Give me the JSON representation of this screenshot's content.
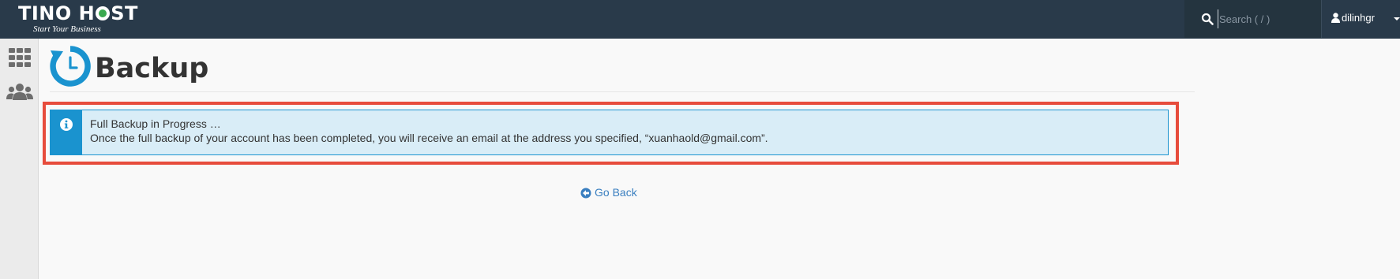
{
  "brand": {
    "name_before": "TINO H",
    "name_after": "ST",
    "tagline": "Start Your Business",
    "accent_color": "#3aa94f"
  },
  "topbar": {
    "background_color": "#293a4a",
    "search": {
      "placeholder": "Search ( / )",
      "icon": "search-icon"
    },
    "user": {
      "username": "dilinhgr",
      "icon": "user-icon"
    }
  },
  "sidebar": {
    "items": [
      {
        "icon": "apps-grid-icon"
      },
      {
        "icon": "users-icon"
      }
    ]
  },
  "page": {
    "title": "Backup",
    "icon": "backup-icon"
  },
  "alert": {
    "type": "info",
    "color": "#1a93cf",
    "title": "Full Backup in Progress …",
    "message": "Once the full backup of your account has been completed, you will receive an email at the address you specified, “xuanhaold@gmail.com”."
  },
  "highlight": {
    "color": "#e74c3c"
  },
  "links": {
    "go_back": "Go Back",
    "go_back_icon": "circle-arrow-left-icon"
  }
}
